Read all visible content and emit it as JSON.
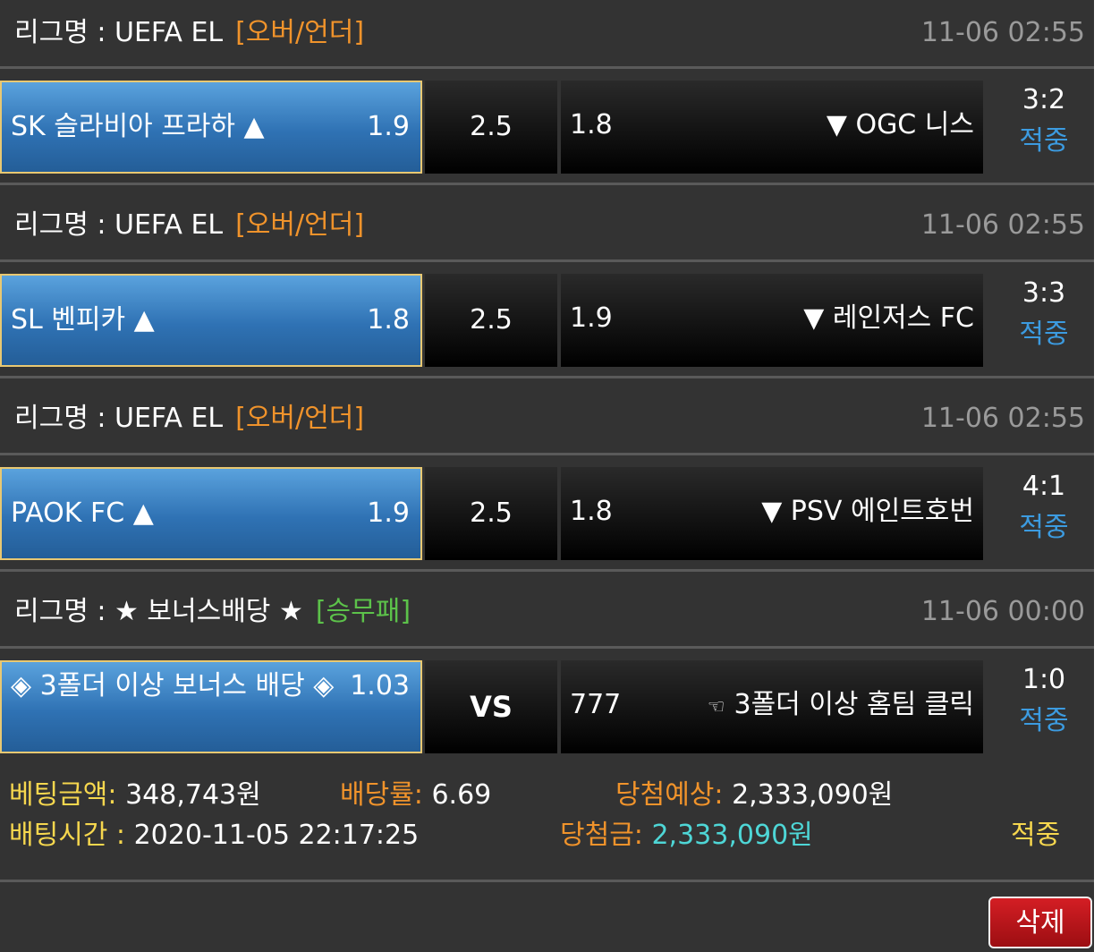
{
  "bets": [
    {
      "league_prefix": "리그명 : UEFA EL",
      "type": "[오버/언더]",
      "datetime": "11-06 02:55",
      "home": "SK 슬라비아 프라하 ▲",
      "home_odd": "1.9",
      "mid": "2.5",
      "away_odd": "1.8",
      "away": "▼ OGC 니스",
      "score": "3:2",
      "status": "적중"
    },
    {
      "league_prefix": "리그명 : UEFA EL",
      "type": "[오버/언더]",
      "datetime": "11-06 02:55",
      "home": "SL 벤피카 ▲",
      "home_odd": "1.8",
      "mid": "2.5",
      "away_odd": "1.9",
      "away": "▼ 레인저스 FC",
      "score": "3:3",
      "status": "적중"
    },
    {
      "league_prefix": "리그명 : UEFA EL",
      "type": "[오버/언더]",
      "datetime": "11-06 02:55",
      "home": "PAOK FC ▲",
      "home_odd": "1.9",
      "mid": "2.5",
      "away_odd": "1.8",
      "away": "▼ PSV 에인트호번",
      "score": "4:1",
      "status": "적중"
    },
    {
      "league_prefix": "리그명 : ★ 보너스배당 ★",
      "type": "[승무패]",
      "datetime": "11-06 00:00",
      "home": "◈ 3폴더 이상 보너스 배당 ◈",
      "home_odd": "1.03",
      "mid": "VS",
      "away_odd": "777",
      "away_hand": "☜",
      "away": "3폴더 이상 홈팀 클릭",
      "score": "1:0",
      "status": "적중"
    }
  ],
  "summary": {
    "bet_amount_label": "베팅금액:",
    "bet_amount": "348,743원",
    "odds_label": "배당률:",
    "odds": "6.69",
    "expected_label": "당첨예상:",
    "expected": "2,333,090원",
    "bet_time_label": "배팅시간 :",
    "bet_time": "2020-11-05 22:17:25",
    "win_label": "당첨금:",
    "win": "2,333,090원",
    "result": "적중"
  },
  "delete_label": "삭제",
  "colors": {
    "bg": "#333333",
    "home_blue": "#2f72b4",
    "gold_border": "#e8c872",
    "type_orange": "#f0932b",
    "type_green": "#5cc24a",
    "status_blue": "#3c9be0",
    "label_yellow": "#f6d74e",
    "win_cyan": "#4ed6d6",
    "delete_red": "#c0161b"
  }
}
